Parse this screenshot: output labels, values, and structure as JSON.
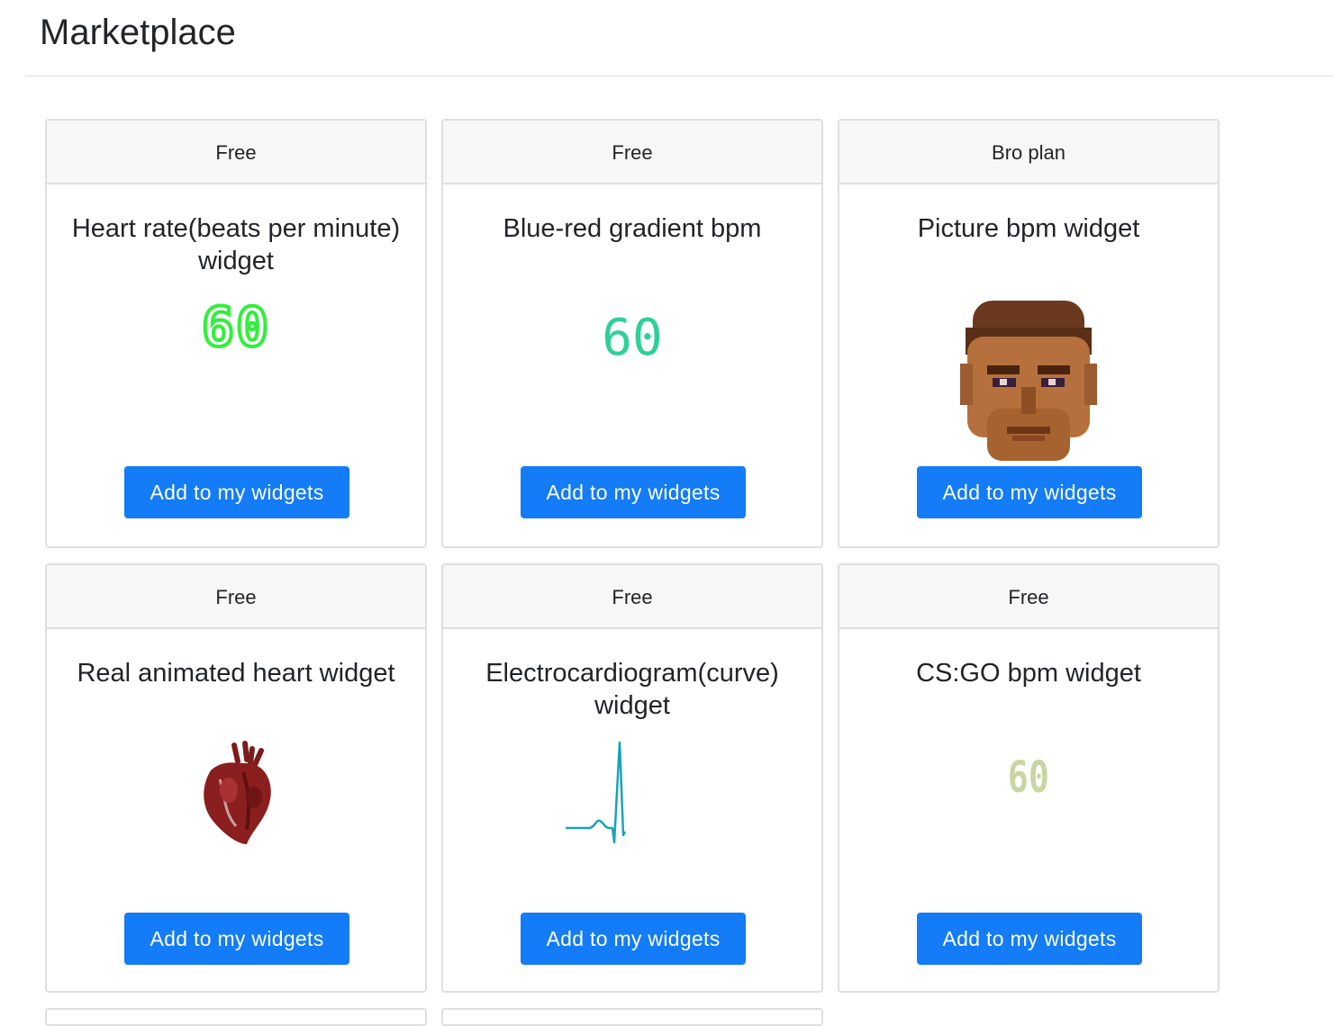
{
  "page": {
    "title": "Marketplace"
  },
  "widgets": [
    {
      "plan": "Free",
      "title": "Heart rate(beats per minute) widget",
      "preview_value": "60",
      "button_label": "Add to my widgets"
    },
    {
      "plan": "Free",
      "title": "Blue-red gradient bpm",
      "preview_value": "60",
      "button_label": "Add to my widgets"
    },
    {
      "plan": "Bro plan",
      "title": "Picture bpm widget",
      "preview_icon": "doom-face-icon",
      "button_label": "Add to my widgets"
    },
    {
      "plan": "Free",
      "title": "Real animated heart widget",
      "preview_icon": "anatomical-heart-icon",
      "button_label": "Add to my widgets"
    },
    {
      "plan": "Free",
      "title": "Electrocardiogram(curve) widget",
      "preview_icon": "ecg-curve-icon",
      "button_label": "Add to my widgets"
    },
    {
      "plan": "Free",
      "title": "CS:GO bpm widget",
      "preview_value": "60",
      "button_label": "Add to my widgets"
    }
  ],
  "colors": {
    "button": "#137cf6",
    "digital_green": "#31ef3a",
    "gradient_teal": "#2fcf9a",
    "csgo_khaki": "#c9d6a4",
    "ecg_teal": "#1aa3b8"
  }
}
